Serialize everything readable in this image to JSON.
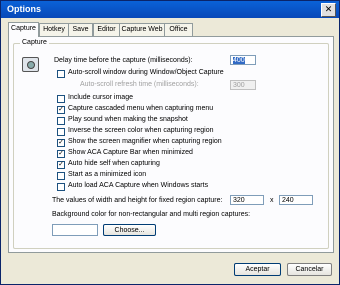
{
  "window": {
    "title": "Options",
    "close_glyph": "✕"
  },
  "tabs": [
    {
      "label": "Capture"
    },
    {
      "label": "Hotkey"
    },
    {
      "label": "Save"
    },
    {
      "label": "Editor"
    },
    {
      "label": "Capture Web"
    },
    {
      "label": "Office"
    }
  ],
  "capture_group": {
    "label": "Capture",
    "icon": "camera-icon",
    "delay_label": "Delay time before the capture (milliseconds):",
    "delay_value": "400",
    "autoscroll_label": "Auto-scroll window during Window/Object Capture",
    "refresh_label": "Auto-scroll refresh time (milliseconds):",
    "refresh_value": "300",
    "options": [
      {
        "label": "Include cursor image",
        "checked": false
      },
      {
        "label": "Capture cascaded menu when capturing menu",
        "checked": true
      },
      {
        "label": "Play sound when making the snapshot",
        "checked": false
      },
      {
        "label": "Inverse the screen color when capturing region",
        "checked": false
      },
      {
        "label": "Show the screen magnifier when capturing region",
        "checked": true
      },
      {
        "label": "Show ACA Capture Bar when minimized",
        "checked": true
      },
      {
        "label": "Auto hide self when capturing",
        "checked": true
      },
      {
        "label": "Start as a minimized icon",
        "checked": false
      },
      {
        "label": "Auto load ACA Capture when Windows starts",
        "checked": false
      }
    ],
    "fixed_region_label": "The values of width and height for fixed region capture:",
    "width_value": "320",
    "x_label": "x",
    "height_value": "240",
    "bg_color_label": "Background color for non-rectangular and multi region captures:",
    "choose_label": "Choose..."
  },
  "footer": {
    "accept_label": "Aceptar",
    "cancel_label": "Cancelar"
  },
  "colors": {
    "title_bar": "#0a62d8",
    "selection": "#316ac5",
    "panel": "#fcfcfe"
  }
}
